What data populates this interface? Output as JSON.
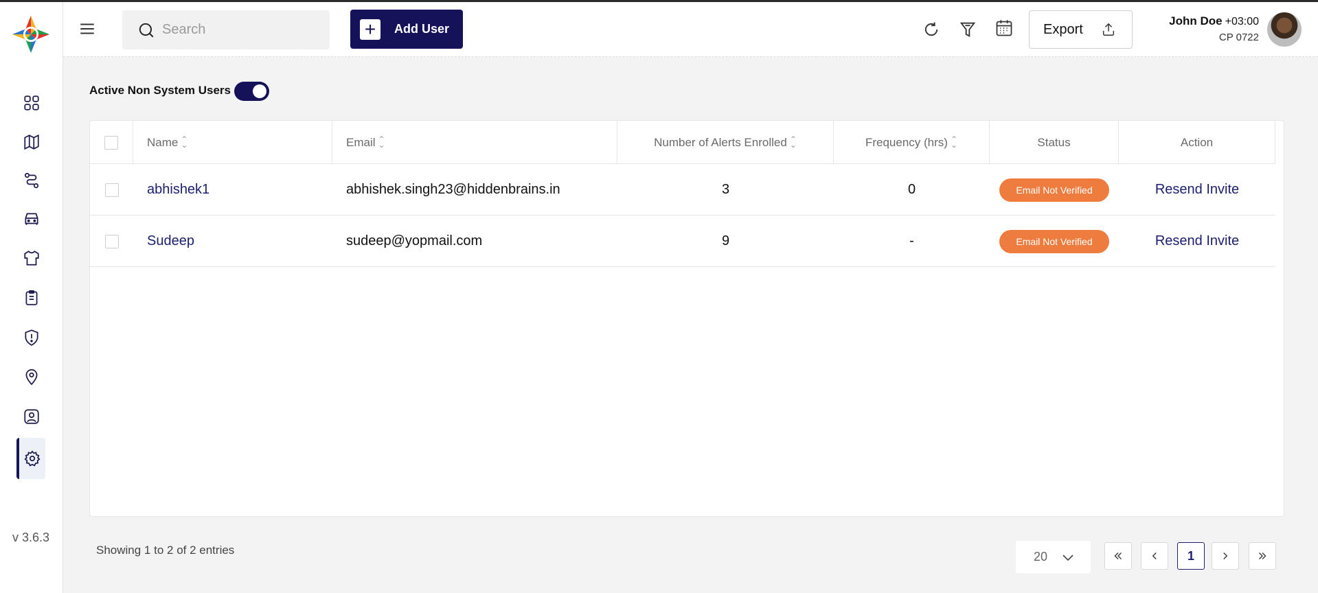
{
  "header": {
    "search_placeholder": "Search",
    "add_user_label": "Add User",
    "export_label": "Export",
    "user": {
      "name": "John Doe",
      "timezone": "+03:00",
      "code": "CP 0722"
    }
  },
  "sidebar": {
    "items": [
      {
        "icon": "dashboard-icon"
      },
      {
        "icon": "map-icon"
      },
      {
        "icon": "route-icon"
      },
      {
        "icon": "vehicle-icon"
      },
      {
        "icon": "shirt-icon"
      },
      {
        "icon": "clipboard-icon"
      },
      {
        "icon": "alert-shield-icon"
      },
      {
        "icon": "location-pin-icon"
      },
      {
        "icon": "user-profile-icon"
      },
      {
        "icon": "settings-icon",
        "active": true
      }
    ],
    "version": "v 3.6.3"
  },
  "filter": {
    "toggle_label": "Active Non System Users",
    "toggle_on": true
  },
  "table": {
    "columns": [
      "Name",
      "Email",
      "Number of Alerts Enrolled",
      "Frequency (hrs)",
      "Status",
      "Action"
    ],
    "rows": [
      {
        "name": "abhishek1",
        "email": "abhishek.singh23@hiddenbrains.in",
        "alerts": "3",
        "frequency": "0",
        "status": "Email Not Verified",
        "action": "Resend Invite"
      },
      {
        "name": "Sudeep",
        "email": "sudeep@yopmail.com",
        "alerts": "9",
        "frequency": "-",
        "status": "Email Not Verified",
        "action": "Resend Invite"
      }
    ]
  },
  "footer": {
    "showing": "Showing 1 to 2 of 2 entries",
    "page_size": "20",
    "current_page": "1"
  },
  "colors": {
    "brand": "#15125a",
    "status_badge": "#ef7c3f",
    "link": "#1b1e6e"
  }
}
